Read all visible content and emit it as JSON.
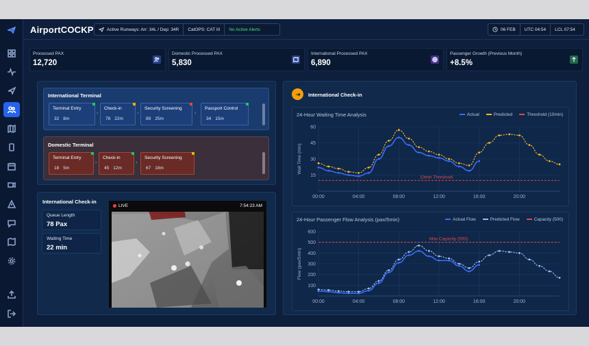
{
  "app": {
    "title": "AirportCOCKPIT"
  },
  "header": {
    "runways": "Active Runways: Arr: 34L / Dep: 34R",
    "catops": "CatOPS: CAT III",
    "alerts": "No Active Alerts",
    "date": "06 FEB",
    "utc": "UTC 04:54",
    "lcl": "LCL 07:54"
  },
  "kpis": [
    {
      "label": "Processed PAX",
      "value": "12,720",
      "icon": "users-icon"
    },
    {
      "label": "Domestic Processed PAX",
      "value": "5,830",
      "icon": "map-icon"
    },
    {
      "label": "International Processed PAX",
      "value": "6,890",
      "icon": "globe-icon"
    },
    {
      "label": "Passenger Growth (Previous Month)",
      "value": "+8.5%",
      "icon": "trend-up-icon"
    }
  ],
  "intl_terminal": {
    "title": "International Terminal",
    "steps": [
      {
        "name": "Terminal Entry",
        "pax": "32",
        "time": "8m",
        "flag_color": "#22c55e"
      },
      {
        "name": "Check-in",
        "pax": "78",
        "time": "22m",
        "flag_color": "#eab308"
      },
      {
        "name": "Security Screening",
        "pax": "89",
        "time": "25m",
        "flag_color": "#ef4444"
      },
      {
        "name": "Passport Control",
        "pax": "34",
        "time": "15m",
        "flag_color": "#22c55e"
      }
    ]
  },
  "dom_terminal": {
    "title": "Domestic Terminal",
    "steps": [
      {
        "name": "Terminal Entry",
        "pax": "18",
        "time": "5m",
        "flag_color": "#22c55e"
      },
      {
        "name": "Check-in",
        "pax": "45",
        "time": "12m",
        "flag_color": "#22c55e"
      },
      {
        "name": "Security Screening",
        "pax": "67",
        "time": "18m",
        "flag_color": "#eab308"
      }
    ]
  },
  "checkin_panel": {
    "title": "International Check-in",
    "queue_label": "Queue Length",
    "queue_value": "78 Pax",
    "wait_label": "Waiting Time",
    "wait_value": "22 min",
    "live_label": "LIVE",
    "camera_time": "7:54:23 AM"
  },
  "right_panel": {
    "title": "International Check-in"
  },
  "colors": {
    "actual": "#3b6cf6",
    "predicted": "#f5b82e",
    "threshold": "#e04a4a",
    "flow_actual": "#3b6cf6",
    "flow_predicted": "#9cc1ff"
  },
  "chart_data": [
    {
      "type": "line",
      "title": "24-Hour Waiting Time Analysis",
      "ylabel": "Wait Time (min)",
      "xlim": [
        0,
        24
      ],
      "ylim": [
        0,
        60
      ],
      "x_ticks": [
        "00:00",
        "04:00",
        "08:00",
        "12:00",
        "16:00",
        "20:00"
      ],
      "y_ticks": [
        15,
        30,
        45,
        60
      ],
      "legend": [
        "Actual",
        "Predicted",
        "Threshold (10min)"
      ],
      "annotation": "10min Threshold",
      "threshold": 10,
      "series": [
        {
          "name": "Actual",
          "x": [
            0,
            1,
            2,
            3,
            4,
            5,
            6,
            7,
            8,
            9,
            10,
            11,
            12,
            13,
            14,
            15,
            16
          ],
          "y": [
            22,
            19,
            17,
            15,
            14,
            17,
            30,
            42,
            50,
            43,
            36,
            33,
            31,
            28,
            23,
            19,
            28
          ]
        },
        {
          "name": "Predicted",
          "x": [
            0,
            1,
            2,
            3,
            4,
            5,
            6,
            7,
            8,
            9,
            10,
            11,
            12,
            13,
            14,
            15,
            16,
            17,
            18,
            19,
            20,
            21,
            22,
            23,
            24
          ],
          "y": [
            26,
            23,
            21,
            18,
            17,
            22,
            34,
            47,
            57,
            49,
            41,
            37,
            34,
            30,
            26,
            24,
            36,
            45,
            52,
            53,
            52,
            43,
            34,
            28,
            25
          ]
        },
        {
          "name": "Threshold (10min)",
          "x": [
            0,
            24
          ],
          "y": [
            10,
            10
          ]
        }
      ]
    },
    {
      "type": "line",
      "title": "24-Hour Passenger Flow Analysis (pax/5min)",
      "ylabel": "Flow (pax/5min)",
      "xlim": [
        0,
        24
      ],
      "ylim": [
        0,
        600
      ],
      "x_ticks": [
        "00:00",
        "04:00",
        "08:00",
        "12:00",
        "16:00",
        "20:00"
      ],
      "y_ticks": [
        100,
        200,
        300,
        400,
        500,
        600
      ],
      "legend": [
        "Actual Flow",
        "Predicted Flow",
        "Capacity (500)"
      ],
      "annotation": "Max Capacity (500)",
      "capacity": 500,
      "series": [
        {
          "name": "Actual Flow",
          "x": [
            0,
            1,
            2,
            3,
            4,
            5,
            6,
            7,
            8,
            9,
            10,
            11,
            12,
            13,
            14,
            15,
            16
          ],
          "y": [
            45,
            40,
            30,
            25,
            25,
            50,
            120,
            220,
            310,
            380,
            420,
            370,
            330,
            330,
            280,
            230,
            290
          ]
        },
        {
          "name": "Predicted Flow",
          "x": [
            0,
            1,
            2,
            3,
            4,
            5,
            6,
            7,
            8,
            9,
            10,
            11,
            12,
            13,
            14,
            15,
            16,
            17,
            18,
            19,
            20,
            21,
            22,
            23,
            24
          ],
          "y": [
            60,
            55,
            45,
            40,
            40,
            70,
            140,
            240,
            340,
            410,
            470,
            420,
            370,
            350,
            300,
            260,
            320,
            380,
            420,
            410,
            400,
            340,
            280,
            230,
            170
          ]
        },
        {
          "name": "Capacity (500)",
          "x": [
            0,
            24
          ],
          "y": [
            500,
            500
          ]
        }
      ]
    }
  ]
}
